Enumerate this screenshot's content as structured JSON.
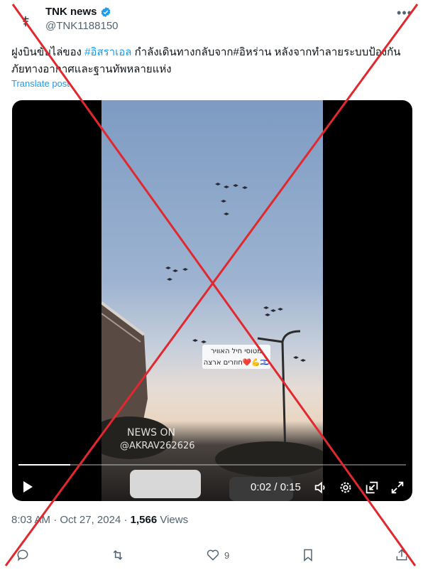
{
  "author": {
    "display_name": "TNK news",
    "handle": "@TNK1188150"
  },
  "tweet": {
    "text_part1": "ฝูงบินขับไล่ของ ",
    "hashtag1": "#อิสราเอล",
    "text_part2": " กำลังเดินทางกลับจาก#อิหร่าน หลังจากทำลายระบบป้องกันภัยทางอากาศและฐานทัพหลายแห่ง",
    "translate_label": "Translate post"
  },
  "video": {
    "caption_line1": "מטוסי חיל האוויר",
    "caption_line2": "חוזרים ארצה❤️💪🇮🇱",
    "watermark_line1": "NEWS ON",
    "watermark_line2": "@AKRAV262626",
    "time_display": "0:02 / 0:15",
    "progress": 0.133
  },
  "meta": {
    "time": "8:03 AM",
    "date": "Oct 27, 2024",
    "views_count": "1,566",
    "views_label": "Views"
  },
  "actions": {
    "like_count": "9"
  },
  "colors": {
    "accent": "#1d9bf0",
    "muted": "#536471",
    "overlay_cross": "#e0282e"
  }
}
